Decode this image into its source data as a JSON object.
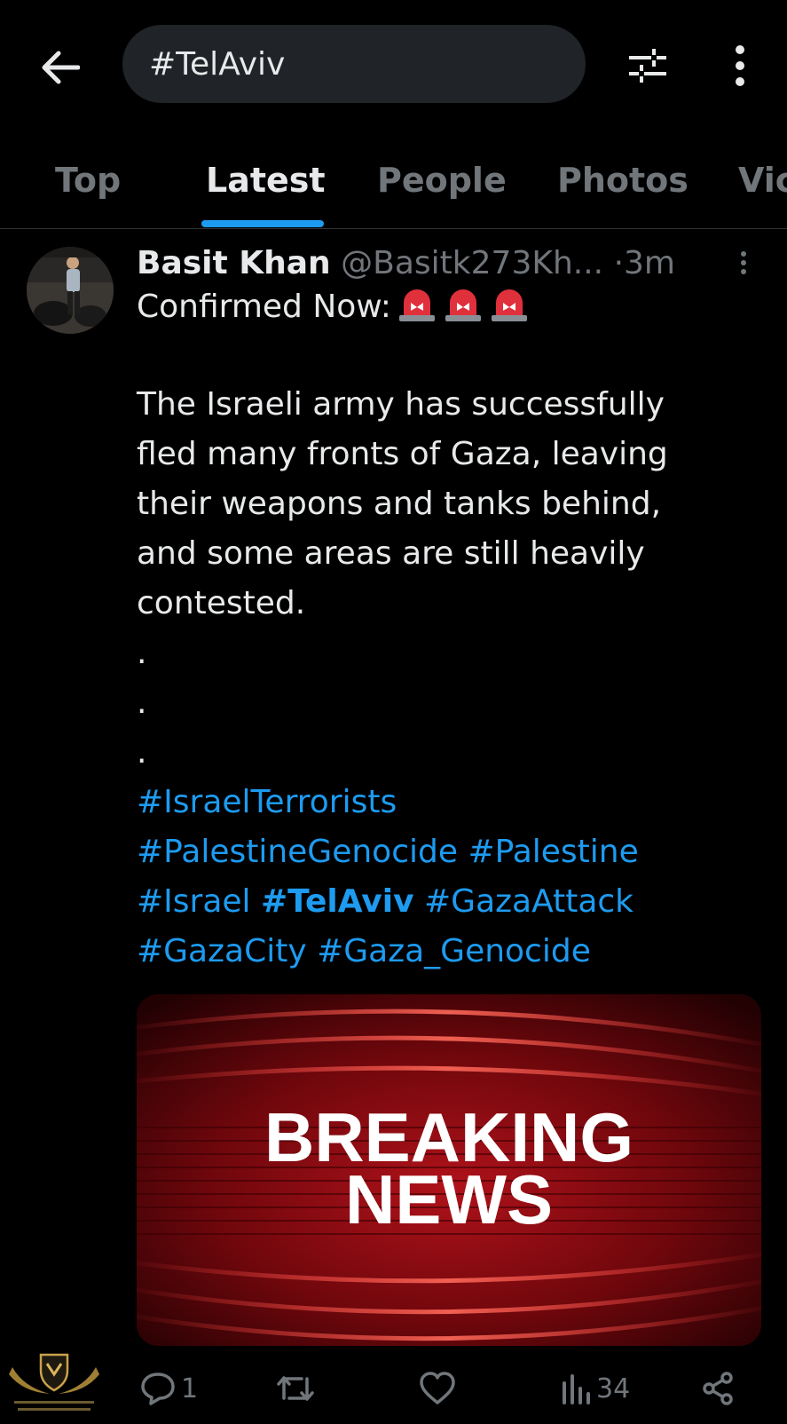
{
  "search": {
    "query": "#TelAviv"
  },
  "tabs": [
    {
      "label": "Top"
    },
    {
      "label": "Latest"
    },
    {
      "label": "People"
    },
    {
      "label": "Photos"
    },
    {
      "label": "Vic"
    }
  ],
  "active_tab": "Latest",
  "tweet": {
    "author_name": "Basit Khan",
    "handle": "@Basitk273Kh...",
    "separator": "·",
    "time": "3m",
    "lines": [
      "Confirmed Now:",
      "The Israeli army has successfully",
      "fled many fronts of Gaza, leaving",
      "their weapons and tanks behind,",
      "and some areas are still heavily",
      "contested.",
      ".",
      ".",
      "."
    ],
    "hashtags": {
      "line1": [
        "#IsraelTerrorists"
      ],
      "line2": [
        "#PalestineGenocide",
        "#Palestine"
      ],
      "line3": [
        "#Israel",
        "#TelAviv",
        "#GazaAttack"
      ],
      "line4": [
        "#GazaCity",
        "#Gaza_Genocide"
      ]
    },
    "media": {
      "line1": "BREAKING",
      "line2": "NEWS"
    },
    "actions": {
      "replies": "1",
      "retweets": "",
      "likes": "",
      "views": "34"
    }
  },
  "colors": {
    "background": "#000000",
    "accent": "#1d9bf0",
    "text_primary": "#e7e9ea",
    "text_secondary": "#71767b"
  },
  "icons": [
    "back-arrow-icon",
    "filter-icon",
    "more-vertical-icon",
    "siren-icon",
    "reply-icon",
    "retweet-icon",
    "like-icon",
    "views-icon",
    "share-icon"
  ]
}
